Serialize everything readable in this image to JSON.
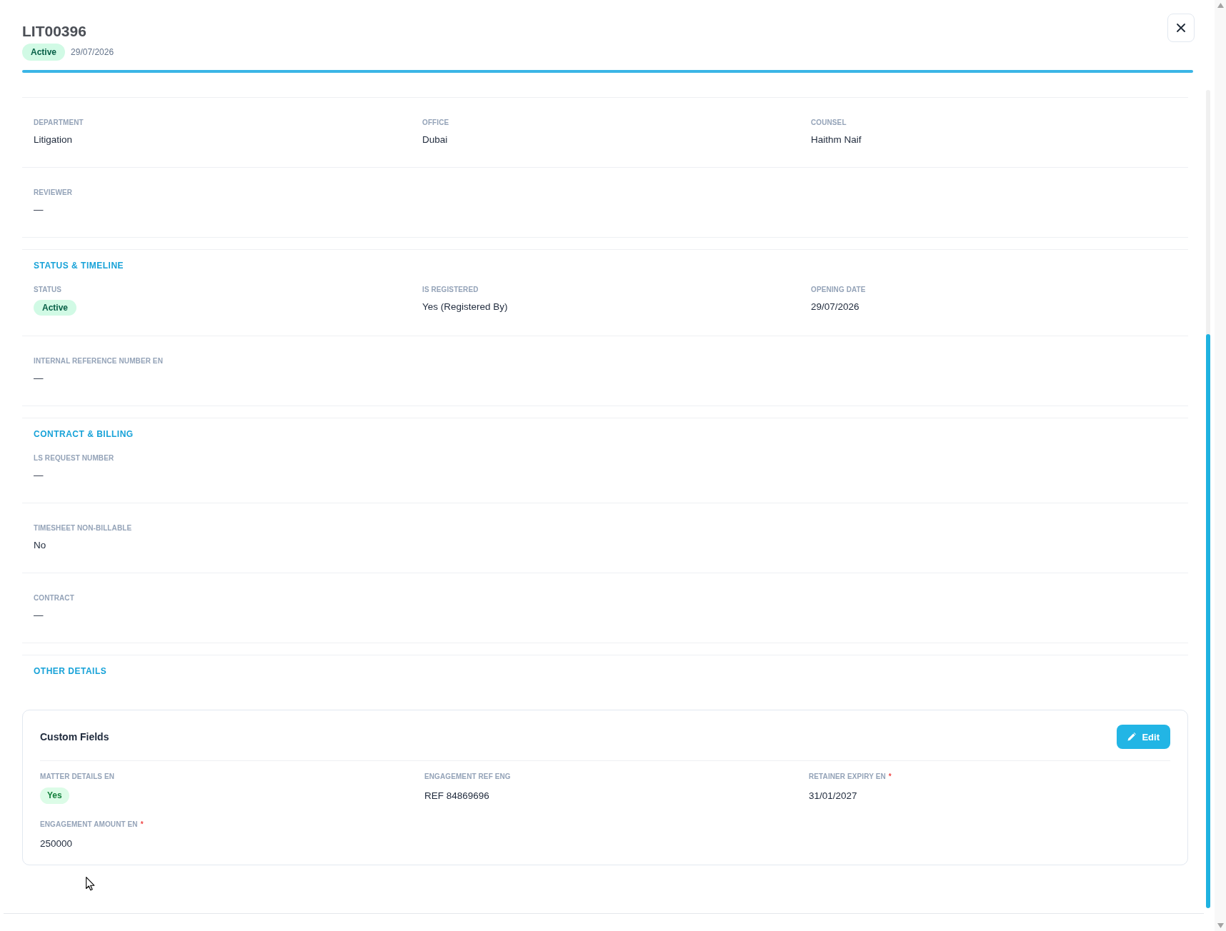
{
  "header": {
    "title": "LIT00396",
    "status": "Active",
    "date": "29/07/2026"
  },
  "sections": [
    {
      "rows": [
        {
          "fields": [
            {
              "label": "DEPARTMENT",
              "value": "Litigation",
              "kind": "text"
            },
            {
              "label": "OFFICE",
              "value": "Dubai",
              "kind": "text"
            },
            {
              "label": "COUNSEL",
              "value": "Haithm Naif",
              "kind": "text"
            }
          ]
        },
        {
          "fields": [
            {
              "label": "REVIEWER",
              "value": "—",
              "kind": "text"
            }
          ]
        }
      ]
    },
    {
      "title": "STATUS & TIMELINE",
      "rows": [
        {
          "fields": [
            {
              "label": "STATUS",
              "value": "Active",
              "kind": "badge"
            },
            {
              "label": "IS REGISTERED",
              "value": "Yes (Registered By)",
              "kind": "text"
            },
            {
              "label": "OPENING DATE",
              "value": "29/07/2026",
              "kind": "text"
            }
          ]
        },
        {
          "fields": [
            {
              "label": "INTERNAL REFERENCE NUMBER EN",
              "value": "—",
              "kind": "text"
            }
          ]
        }
      ]
    },
    {
      "title": "CONTRACT & BILLING",
      "rows": [
        {
          "fields": [
            {
              "label": "LS REQUEST NUMBER",
              "value": "—",
              "kind": "text"
            }
          ]
        },
        {
          "fields": [
            {
              "label": "TIMESHEET NON-BILLABLE",
              "value": "No",
              "kind": "text"
            }
          ]
        },
        {
          "fields": [
            {
              "label": "CONTRACT",
              "value": "—",
              "kind": "text"
            }
          ]
        }
      ]
    },
    {
      "title": "OTHER DETAILS",
      "custom_fields": {
        "title": "Custom Fields",
        "edit_button": "Edit",
        "fields": [
          {
            "label": "MATTER DETAILS EN",
            "value": "Yes",
            "kind": "badge"
          },
          {
            "label": "ENGAGEMENT REF ENG",
            "value": "REF 84869696",
            "kind": "text"
          },
          {
            "label": "RETAINER EXPIRY EN",
            "required_mark": "*",
            "value": "31/01/2027",
            "kind": "text"
          },
          {
            "label": "ENGAGEMENT AMOUNT EN",
            "required_mark": "*",
            "value": "250000",
            "kind": "text"
          }
        ]
      }
    }
  ]
}
